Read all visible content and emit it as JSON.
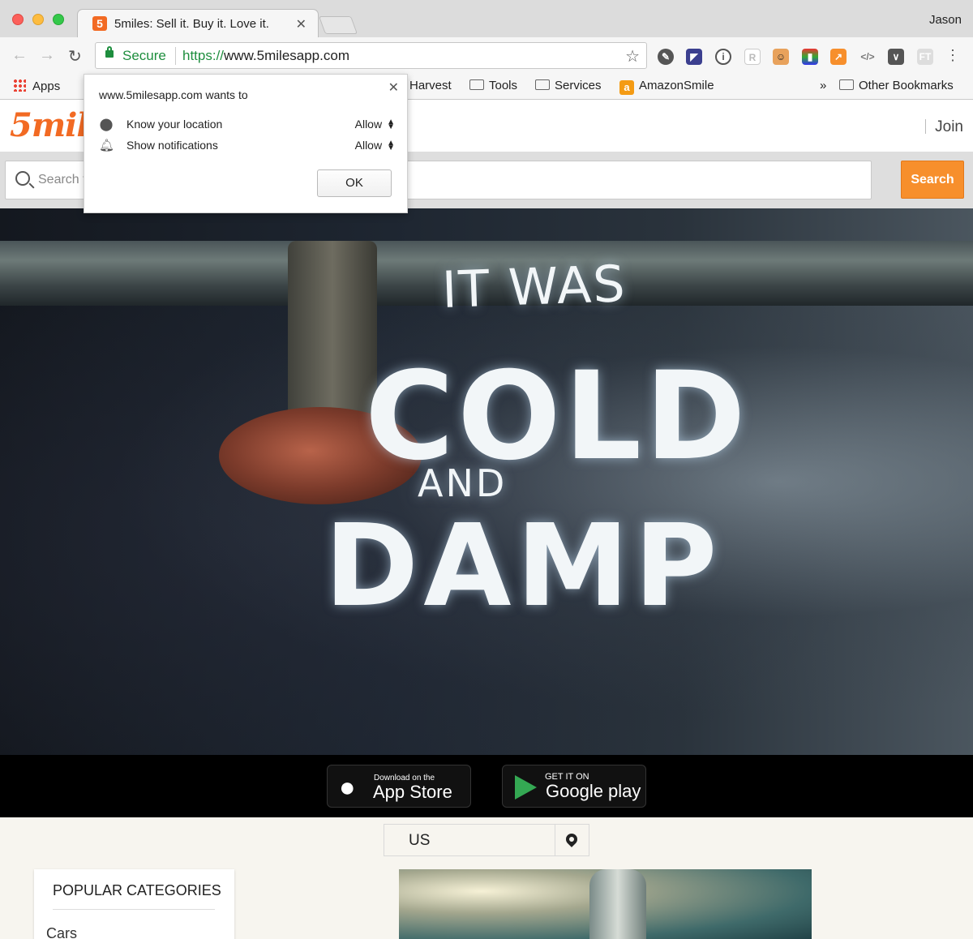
{
  "browser": {
    "tab_title": "5miles: Sell it. Buy it. Love it.",
    "tab_favicon": "5",
    "user_name": "Jason",
    "omnibox": {
      "secure_label": "Secure",
      "url_scheme": "https://",
      "url_host": "www.5milesapp.com"
    },
    "extension_icons": [
      "rss-icon",
      "vue-devtools-icon",
      "onepassword-icon",
      "readability-icon",
      "avatar-extension-icon",
      "color-extension-icon",
      "analytics-icon",
      "code-icon",
      "pocket-icon",
      "ft-icon"
    ],
    "bookmarks": {
      "apps": "Apps",
      "harvest": "Harvest",
      "tools": "Tools",
      "services": "Services",
      "amazon_smile": "AmazonSmile",
      "overflow": "»",
      "other": "Other Bookmarks"
    }
  },
  "permission_popup": {
    "title": "www.5milesapp.com wants to",
    "rows": [
      {
        "label": "Know your location",
        "value": "Allow",
        "icon": "location-pin-icon"
      },
      {
        "label": "Show notifications",
        "value": "Allow",
        "icon": "bell-icon"
      }
    ],
    "ok_label": "OK"
  },
  "site": {
    "logo_text": "5mile",
    "join_label": "Join",
    "search": {
      "placeholder": "Search f",
      "button_label": "Search"
    },
    "hero": {
      "line1": "IT WAS",
      "line2": "COLD",
      "line3": "AND",
      "line4": "DAMP"
    },
    "app_badges": {
      "apple_small": "Download on the",
      "apple_big": "App Store",
      "google_small": "GET IT ON",
      "google_big": "Google play"
    },
    "location": "US",
    "categories": {
      "heading": "POPULAR CATEGORIES",
      "first_item": "Cars"
    }
  },
  "colors": {
    "brand_orange": "#f26a23",
    "search_button": "#f78f2c",
    "secure_green": "#1e8e3e"
  }
}
